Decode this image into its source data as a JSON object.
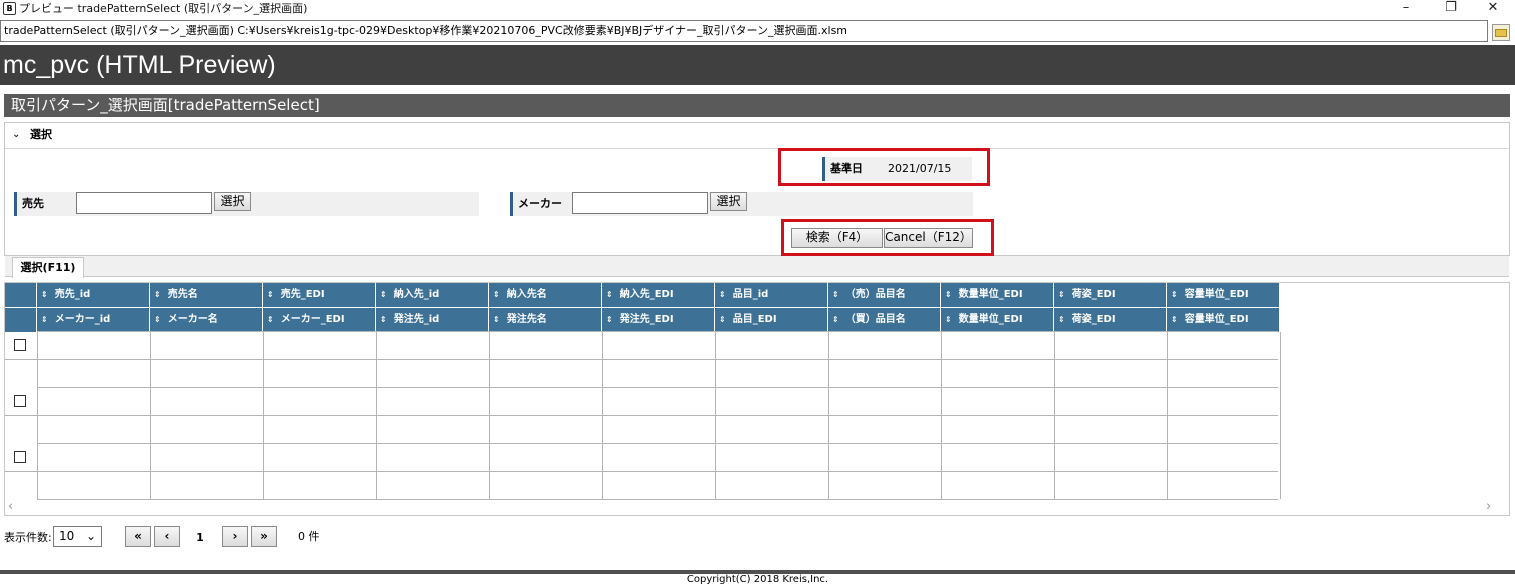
{
  "window": {
    "title": "プレビュー tradePatternSelect (取引パターン_選択画面)",
    "minimize": "–",
    "restore": "❐",
    "close": "✕"
  },
  "path_bar": {
    "text": "tradePatternSelect (取引パターン_選択画面) C:¥Users¥kreis1g-tpc-029¥Desktop¥移作業¥20210706_PVC改修要素¥BJ¥BJデザイナー_取引パターン_選択画面.xlsm"
  },
  "header": {
    "title": "mc_pvc (HTML Preview)"
  },
  "page": {
    "title": "取引パターン_選択画面[tradePatternSelect]"
  },
  "panel": {
    "title": "選択",
    "base_date_label": "基準日",
    "base_date_value": "2021/07/15",
    "seller_label": "売先",
    "seller_value": "",
    "seller_select": "選択",
    "maker_label": "メーカー",
    "maker_value": "",
    "maker_select": "選択",
    "search_button": "検索（F4）",
    "cancel_button": "Cancel（F12）"
  },
  "tab": {
    "label": "選択(F11)"
  },
  "grid": {
    "sort_icon": "⇕",
    "header_row1": [
      "売先_id",
      "売先名",
      "売先_EDI",
      "納入先_id",
      "納入先名",
      "納入先_EDI",
      "品目_id",
      "（売）品目名",
      "数量単位_EDI",
      "荷姿_EDI",
      "容量単位_EDI"
    ],
    "header_row2": [
      "メーカー_id",
      "メーカー名",
      "メーカー_EDI",
      "発注先_id",
      "発注先名",
      "発注先_EDI",
      "品目_EDI",
      "（買）品目名",
      "数量単位_EDI",
      "荷姿_EDI",
      "容量単位_EDI"
    ],
    "record_count": 3
  },
  "pager": {
    "label": "表示件数:",
    "page_size": "10",
    "first": "«",
    "prev": "‹",
    "current_page": "1",
    "next": "›",
    "last": "»",
    "count_text": "0 件"
  },
  "footer": {
    "copyright": "Copyright(C) 2018 Kreis,Inc."
  }
}
